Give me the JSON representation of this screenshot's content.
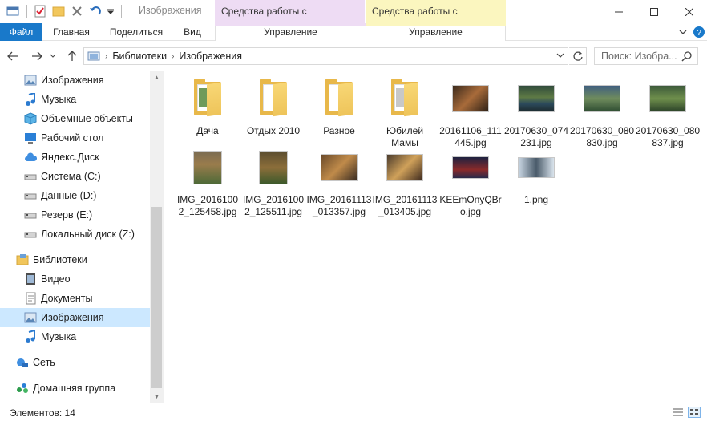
{
  "window": {
    "title": "Изображения",
    "context_libraries": "Средства работы с библиотекой",
    "context_pictures": "Средства работы с рисунками"
  },
  "ribbon": {
    "tabs": {
      "file": "Файл",
      "home": "Главная",
      "share": "Поделиться",
      "view": "Вид",
      "manage_lib": "Управление",
      "manage_pic": "Управление"
    }
  },
  "address": {
    "crumbs": [
      "Библиотеки",
      "Изображения"
    ],
    "search_placeholder": "Поиск: Изобра..."
  },
  "nav": {
    "items": [
      {
        "label": "Изображения",
        "icon": "pictures-icon"
      },
      {
        "label": "Музыка",
        "icon": "music-icon"
      },
      {
        "label": "Объемные объекты",
        "icon": "3d-objects-icon"
      },
      {
        "label": "Рабочий стол",
        "icon": "desktop-icon"
      },
      {
        "label": "Яндекс.Диск",
        "icon": "cloud-icon"
      },
      {
        "label": "Система (C:)",
        "icon": "drive-icon"
      },
      {
        "label": "Данные (D:)",
        "icon": "drive-icon"
      },
      {
        "label": "Резерв (E:)",
        "icon": "drive-icon"
      },
      {
        "label": "Локальный диск (Z:)",
        "icon": "drive-icon"
      },
      {
        "label": "Библиотеки",
        "icon": "libraries-icon"
      },
      {
        "label": "Видео",
        "icon": "video-icon"
      },
      {
        "label": "Документы",
        "icon": "documents-icon"
      },
      {
        "label": "Изображения",
        "icon": "pictures-icon"
      },
      {
        "label": "Музыка",
        "icon": "music-icon"
      },
      {
        "label": "Сеть",
        "icon": "network-icon"
      },
      {
        "label": "Домашняя группа",
        "icon": "homegroup-icon"
      }
    ]
  },
  "files": [
    {
      "name": "Дача",
      "kind": "folder"
    },
    {
      "name": "Отдых 2010",
      "kind": "folder"
    },
    {
      "name": "Разное",
      "kind": "folder"
    },
    {
      "name": "Юбилей Мамы",
      "kind": "folder"
    },
    {
      "name": "20161106_111445.jpg",
      "kind": "photo"
    },
    {
      "name": "20170630_074231.jpg",
      "kind": "photo"
    },
    {
      "name": "20170630_080830.jpg",
      "kind": "photo"
    },
    {
      "name": "20170630_080837.jpg",
      "kind": "photo"
    },
    {
      "name": "IMG_20161002_125458.jpg",
      "kind": "photo"
    },
    {
      "name": "IMG_20161002_125511.jpg",
      "kind": "photo"
    },
    {
      "name": "IMG_20161113_013357.jpg",
      "kind": "photo"
    },
    {
      "name": "IMG_20161113_013405.jpg",
      "kind": "photo"
    },
    {
      "name": "KEEmOnyQBro.jpg",
      "kind": "photo"
    },
    {
      "name": "1.png",
      "kind": "photo"
    }
  ],
  "status": {
    "count": "Элементов: 14"
  },
  "colors": {
    "accent": "#1979ca",
    "selection": "#cce8ff",
    "context_libraries": "#eedcf4",
    "context_pictures": "#fbf6bf"
  }
}
